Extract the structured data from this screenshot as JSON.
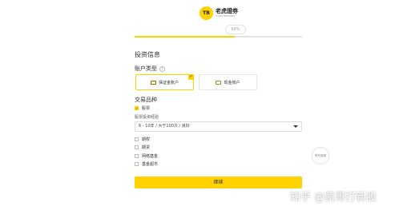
{
  "brand": {
    "logo_mark": "tiger",
    "name": "老虎證券",
    "subtitle": "TIGER BROKERS"
  },
  "progress": {
    "percent": 60,
    "label": "60%",
    "fill_color": "#ffd200"
  },
  "form": {
    "section_title": "投资信息",
    "account_type_label": "账户类型",
    "account_types": [
      {
        "label": "保证金账户",
        "selected": true,
        "icon": "margin-account-icon"
      },
      {
        "label": "现金账户",
        "selected": false,
        "icon": "cash-account-icon"
      }
    ],
    "trade_types_label": "交易品种",
    "trade_types": [
      {
        "label": "股票",
        "checked": true
      },
      {
        "label": "期权",
        "checked": false
      },
      {
        "label": "期货",
        "checked": false
      },
      {
        "label": "网络基金",
        "checked": false
      },
      {
        "label": "基金超市",
        "checked": false
      }
    ],
    "stock_experience_label": "股票投资经验",
    "stock_experience_value": "6 - 10年 / 大于100次 / 良好"
  },
  "side": {
    "service_label": "联系客服"
  },
  "actions": {
    "continue_label": "继续"
  },
  "watermark": "知乎 @凯哥打新股",
  "colors": {
    "accent": "#ffd200",
    "border": "#e6e6e6",
    "text": "#333333"
  }
}
